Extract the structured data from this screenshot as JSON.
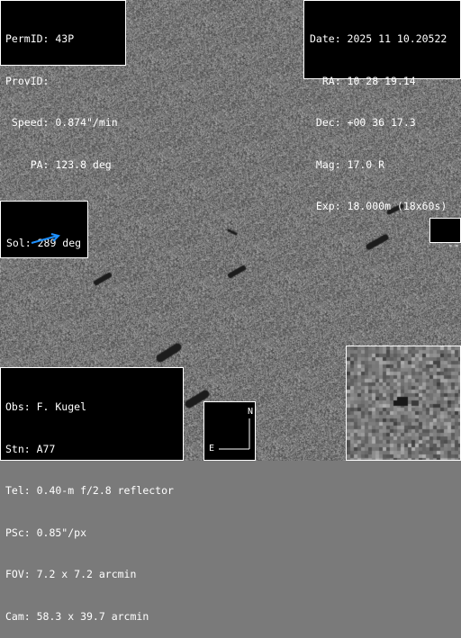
{
  "object": {
    "permid": "PermID: 43P",
    "provid": "ProvID:",
    "speed": " Speed: 0.874\"/min",
    "pa": "    PA: 123.8 deg"
  },
  "exposure": {
    "date": "Date: 2025 11 10.20522",
    "ra": "  RA: 10 28 19.14",
    "dec": " Dec: +00 36 17.3",
    "mag": " Mag: 17.0 R",
    "exp": " Exp: 18.000m (18x60s)"
  },
  "sun": {
    "label": "Sol: 289 deg",
    "arrow_color": "#1e90ff",
    "arrow_icon": "sun-direction-arrow-icon"
  },
  "motion_indicator": {
    "label": "---"
  },
  "observer": {
    "obs": "Obs: F. Kugel",
    "stn": "Stn: A77",
    "tel": "Tel: 0.40-m f/2.8 reflector",
    "psc": "PSc: 0.85\"/px",
    "fov": "FOV: 7.2 x 7.2 arcmin",
    "cam": "Cam: 58.3 x 39.7 arcmin"
  },
  "compass": {
    "north": "N",
    "east": "E",
    "icon": "north-east-compass-icon"
  },
  "colors": {
    "background_gray": "#7a7a7a",
    "panel_bg": "#000000",
    "panel_text": "#ffffff",
    "star_streak": "#1a1a1a"
  }
}
